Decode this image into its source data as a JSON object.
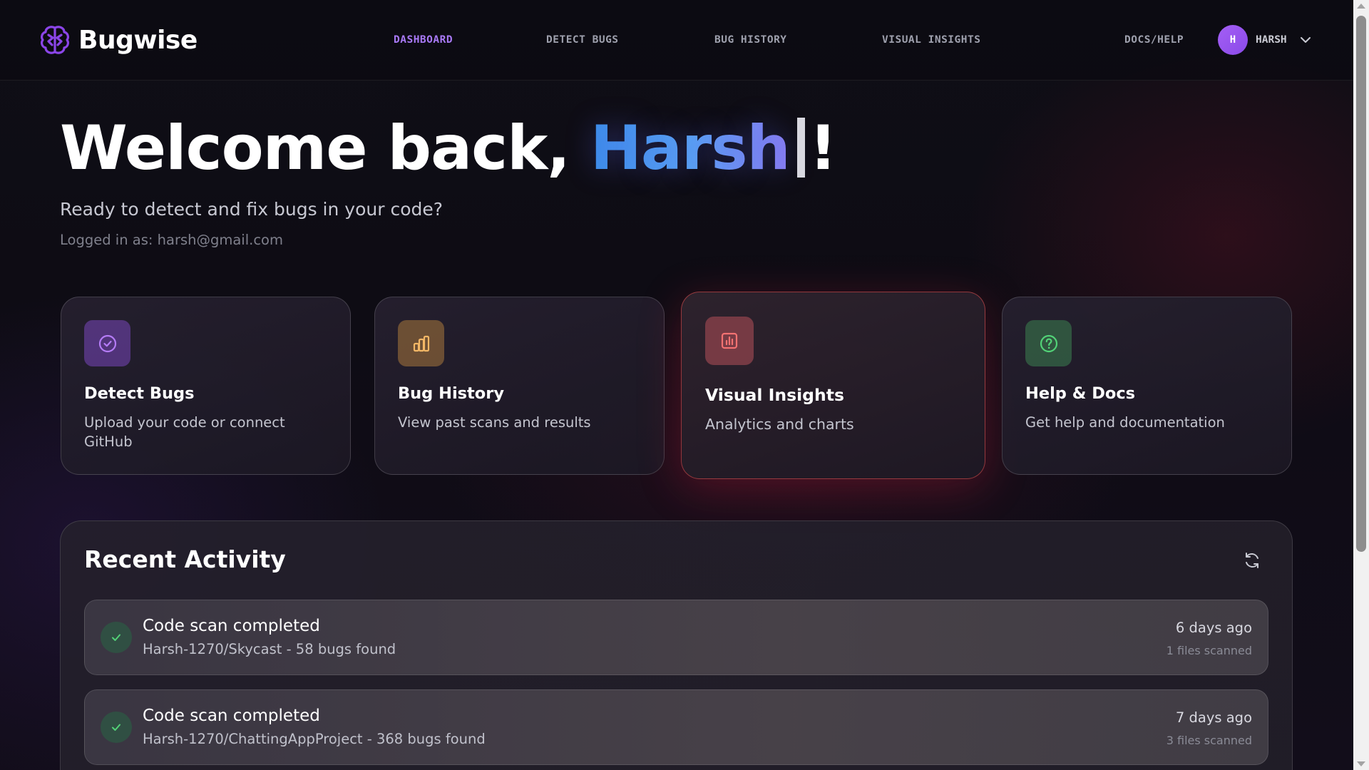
{
  "brand": {
    "name": "Bugwise",
    "icon": "brain-icon",
    "color": "#8b45e8"
  },
  "nav": {
    "links": [
      {
        "label": "DASHBOARD",
        "active": true
      },
      {
        "label": "DETECT BUGS",
        "active": false
      },
      {
        "label": "BUG HISTORY",
        "active": false
      },
      {
        "label": "VISUAL INSIGHTS",
        "active": false
      },
      {
        "label": "DOCS/HELP",
        "active": false
      }
    ],
    "user": {
      "initial": "H",
      "name": "HARSH",
      "avatar_color": "#a45ff5"
    }
  },
  "hero": {
    "greeting": "Welcome back, ",
    "name": "Harsh",
    "exclaim": "!",
    "subtitle": "Ready to detect and fix bugs in your code?",
    "logged_in": "Logged in as: harsh@gmail.com"
  },
  "cards": [
    {
      "title": "Detect Bugs",
      "description": "Upload your code or connect GitHub",
      "icon": "check-circle-icon",
      "accent": "#a56ef5"
    },
    {
      "title": "Bug History",
      "description": "View past scans and results",
      "icon": "bar-chart-icon",
      "accent": "#f0b05a"
    },
    {
      "title": "Visual Insights",
      "description": "Analytics and charts",
      "icon": "chart-square-icon",
      "accent": "#f06a6a"
    },
    {
      "title": "Help & Docs",
      "description": "Get help and documentation",
      "icon": "help-circle-icon",
      "accent": "#4ecf6f"
    }
  ],
  "activity": {
    "title": "Recent Activity",
    "refresh_icon": "refresh-icon",
    "items": [
      {
        "title": "Code scan completed",
        "subtitle": "Harsh-1270/Skycast - 58 bugs found",
        "time": "6 days ago",
        "files": "1 files scanned",
        "status_color": "#4ecf6f"
      },
      {
        "title": "Code scan completed",
        "subtitle": "Harsh-1270/ChattingAppProject - 368 bugs found",
        "time": "7 days ago",
        "files": "3 files scanned",
        "status_color": "#4ecf6f"
      }
    ]
  }
}
